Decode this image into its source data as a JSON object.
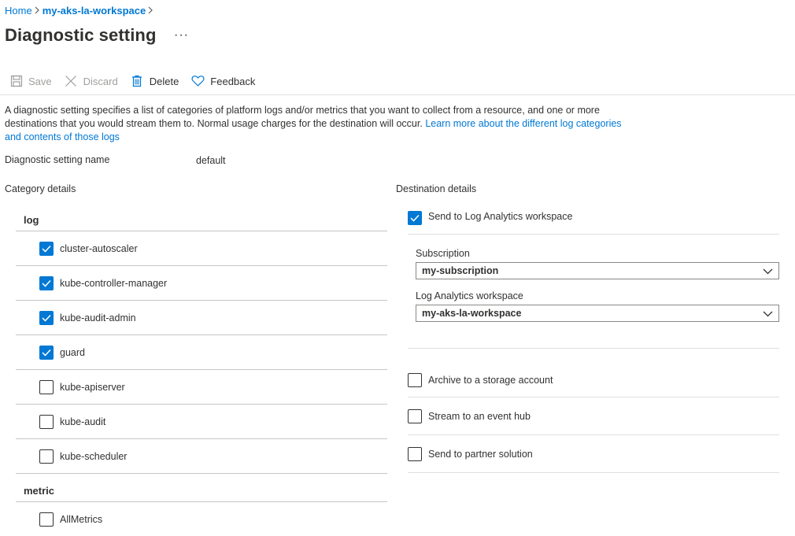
{
  "breadcrumb": {
    "home": "Home",
    "workspace": "my-aks-la-workspace",
    "sep": ">"
  },
  "page": {
    "title": "Diagnostic setting",
    "more": "···"
  },
  "toolbar": {
    "save": "Save",
    "discard": "Discard",
    "delete": "Delete",
    "feedback": "Feedback"
  },
  "description": {
    "text": "A diagnostic setting specifies a list of categories of platform logs and/or metrics that you want to collect from a resource, and one or more destinations that you would stream them to. Normal usage charges for the destination will occur. ",
    "link": "Learn more about the different log categories and contents of those logs"
  },
  "setting_name": {
    "label": "Diagnostic setting name",
    "value": "default"
  },
  "category_details": {
    "label": "Category details",
    "log_header": "log",
    "logs": [
      {
        "label": "cluster-autoscaler",
        "checked": true
      },
      {
        "label": "kube-controller-manager",
        "checked": true
      },
      {
        "label": "kube-audit-admin",
        "checked": true
      },
      {
        "label": "guard",
        "checked": true
      },
      {
        "label": "kube-apiserver",
        "checked": false
      },
      {
        "label": "kube-audit",
        "checked": false
      },
      {
        "label": "kube-scheduler",
        "checked": false
      }
    ],
    "metric_header": "metric",
    "metrics": [
      {
        "label": "AllMetrics",
        "checked": false
      }
    ]
  },
  "destination_details": {
    "label": "Destination details",
    "log_analytics": {
      "label": "Send to Log Analytics workspace",
      "checked": true
    },
    "subscription": {
      "label": "Subscription",
      "value": "my-subscription"
    },
    "workspace": {
      "label": "Log Analytics workspace",
      "value": "my-aks-la-workspace"
    },
    "storage": {
      "label": "Archive to a storage account",
      "checked": false
    },
    "event_hub": {
      "label": "Stream to an event hub",
      "checked": false
    },
    "partner": {
      "label": "Send to partner solution",
      "checked": false
    }
  },
  "colors": {
    "accent": "#0078d4",
    "text": "#323130",
    "disabled": "#a19f9d",
    "divider": "#c8c6c4"
  }
}
